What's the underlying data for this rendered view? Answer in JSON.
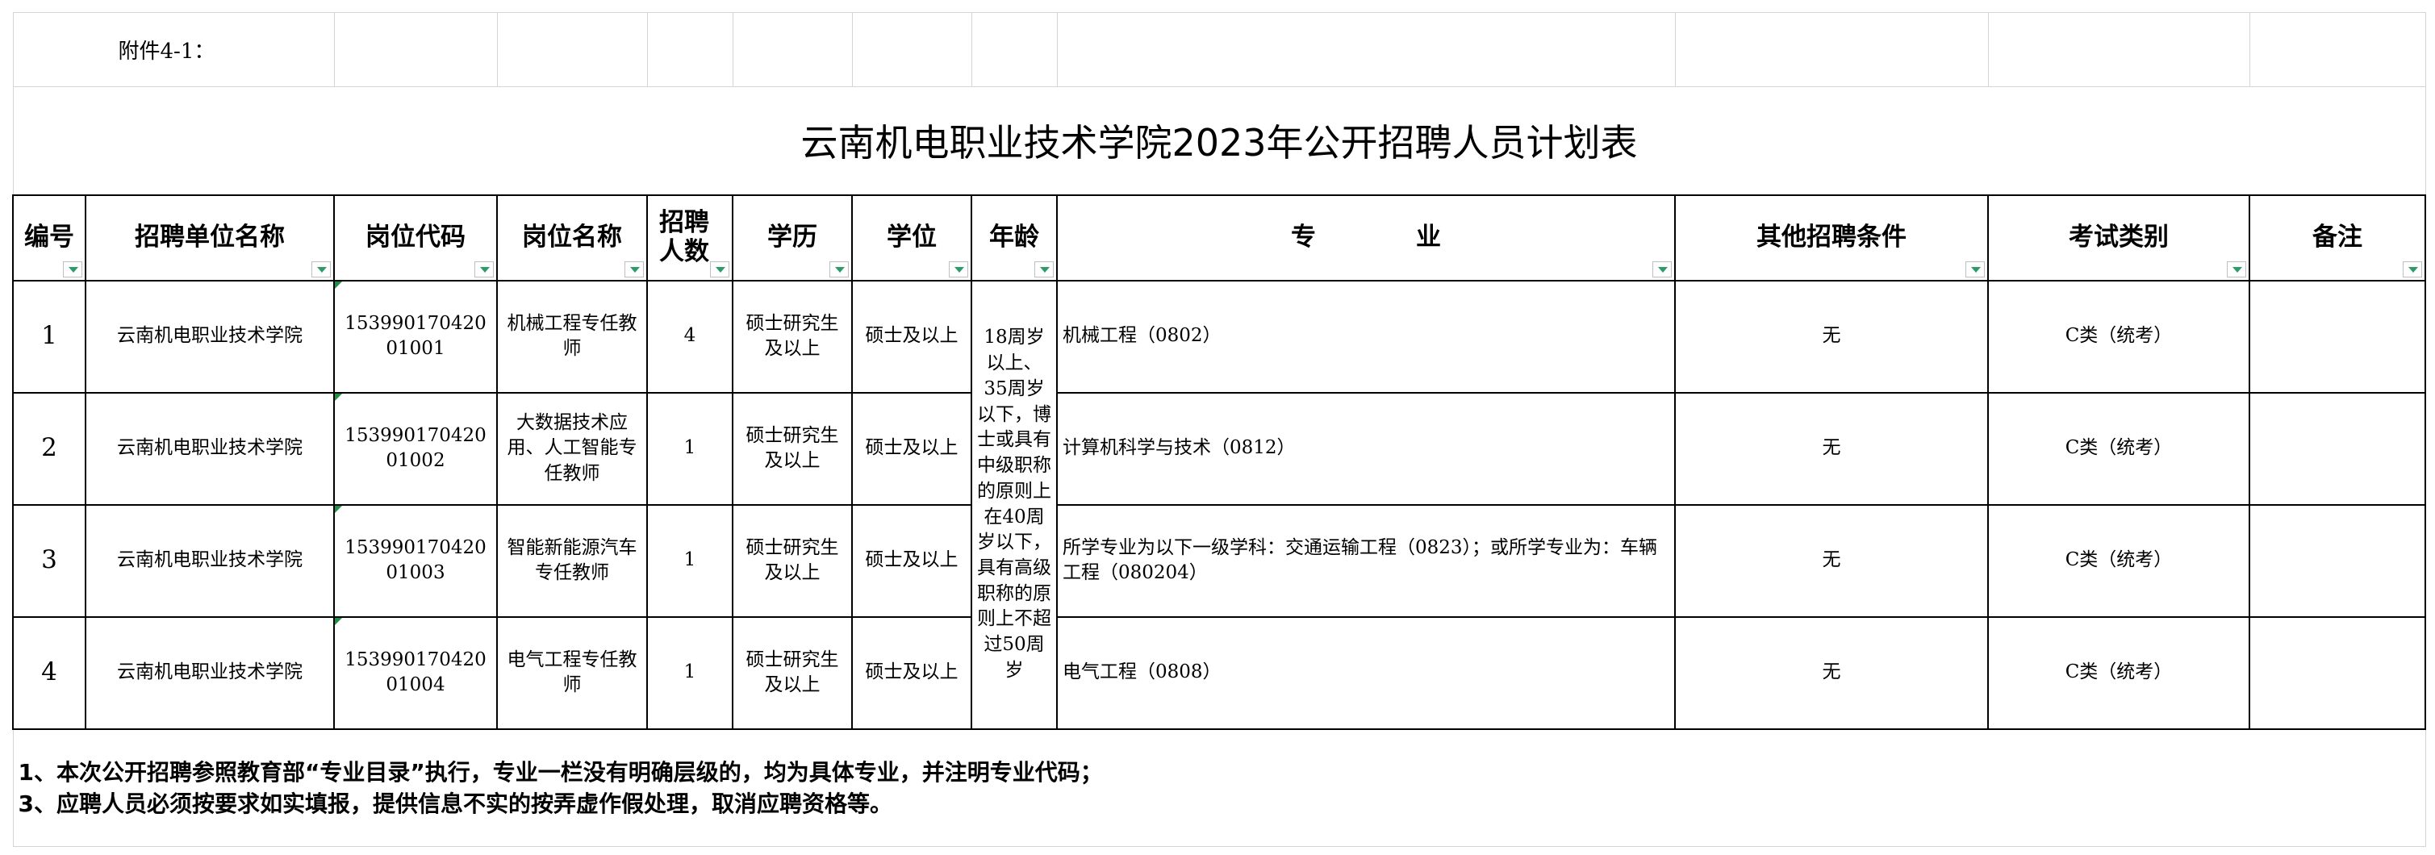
{
  "attachment_label": "附件4-1：",
  "title": "云南机电职业技术学院2023年公开招聘人员计划表",
  "headers": {
    "no": "编号",
    "unit": "招聘单位名称",
    "code": "岗位代码",
    "post": "岗位名称",
    "count": "招聘人数",
    "edu": "学历",
    "degree": "学位",
    "age": "年龄",
    "major": "专　　　　业",
    "other": "其他招聘条件",
    "exam": "考试类别",
    "remark": "备注"
  },
  "age_requirement": "18周岁以上、35周岁以下，博士或具有中级职称的原则上在40周岁以下，具有高级职称的原则上不超过50周岁",
  "rows": [
    {
      "no": "1",
      "unit": "云南机电职业技术学院",
      "code": "15399017042001001",
      "post": "机械工程专任教师",
      "count": "4",
      "edu": "硕士研究生及以上",
      "degree": "硕士及以上",
      "major": "机械工程（0802）",
      "other": "无",
      "exam": "C类（统考）",
      "remark": ""
    },
    {
      "no": "2",
      "unit": "云南机电职业技术学院",
      "code": "15399017042001002",
      "post": "大数据技术应用、人工智能专任教师",
      "count": "1",
      "edu": "硕士研究生及以上",
      "degree": "硕士及以上",
      "major": "计算机科学与技术（0812）",
      "other": "无",
      "exam": "C类（统考）",
      "remark": ""
    },
    {
      "no": "3",
      "unit": "云南机电职业技术学院",
      "code": "15399017042001003",
      "post": "智能新能源汽车专任教师",
      "count": "1",
      "edu": "硕士研究生及以上",
      "degree": "硕士及以上",
      "major": "所学专业为以下一级学科：交通运输工程（0823）；或所学专业为：车辆工程（080204）",
      "other": "无",
      "exam": "C类（统考）",
      "remark": ""
    },
    {
      "no": "4",
      "unit": "云南机电职业技术学院",
      "code": "15399017042001004",
      "post": "电气工程专任教师",
      "count": "1",
      "edu": "硕士研究生及以上",
      "degree": "硕士及以上",
      "major": "电气工程（0808）",
      "other": "无",
      "exam": "C类（统考）",
      "remark": ""
    }
  ],
  "notes": [
    "1、本次公开招聘参照教育部“专业目录”执行，专业一栏没有明确层级的，均为具体专业，并注明专业代码；",
    "3、应聘人员必须按要求如实填报，提供信息不实的按弄虚作假处理，取消应聘资格等。"
  ],
  "colors": {
    "filter_arrow": "#2e9c6a",
    "comment_marker": "#1f8f4a",
    "gridline": "#d4d4d4"
  }
}
